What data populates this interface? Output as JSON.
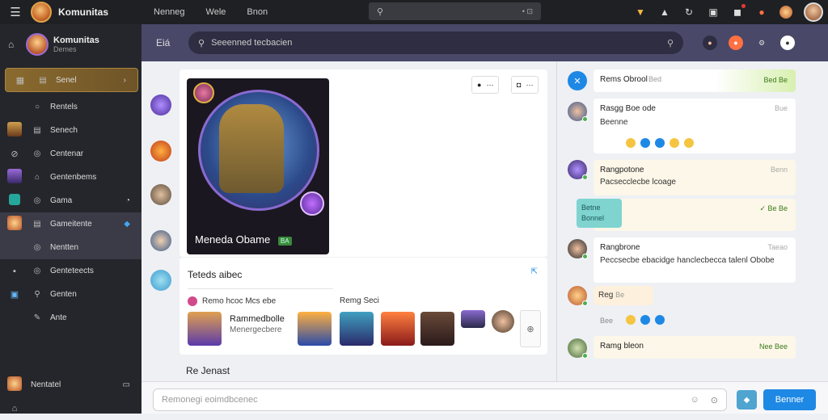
{
  "topbar": {
    "brand": "Komunitas",
    "nav": [
      "Nenneg",
      "Wele",
      "Bnon"
    ],
    "search_dots": "• ⊡"
  },
  "sidebar": {
    "title": "Komunitas",
    "subtitle": "Demes",
    "items": [
      {
        "label": "Senel",
        "end": "›"
      },
      {
        "label": "Rentels"
      },
      {
        "label": "Senech"
      },
      {
        "label": "Centenar"
      },
      {
        "label": "Gentenbems"
      },
      {
        "label": "Gama"
      },
      {
        "label": "Gameitente"
      },
      {
        "label": "Nentten"
      },
      {
        "label": "Genteteects"
      },
      {
        "label": "Genten"
      },
      {
        "label": "Ante"
      }
    ],
    "bottom_label": "Nentatel"
  },
  "subbar": {
    "back_label": "Eiá",
    "search_placeholder": "Seeenned tecbacien"
  },
  "game_card": {
    "title": "Meneda Obame",
    "tag": "BA",
    "btn1": "●",
    "btn2": "◘"
  },
  "lower_card": {
    "heading": "Teteds aibec",
    "col1": "Remo hcoc Mcs ebe",
    "col2": "Remg Seci",
    "game_name": "Rammedbolle",
    "game_sub": "Menergecbere"
  },
  "footer_label": "Re Jenast",
  "chat": [
    {
      "name": "Rems Obrool",
      "time": "Bed",
      "tag": "Bed Be"
    },
    {
      "name": "Rasgg Boe ode",
      "time": "Bue",
      "body": "Beenne"
    },
    {
      "name": "Rangpotone",
      "time": "Benn",
      "body": "Pacsecclecbe lcoage"
    },
    {
      "name": "Rangbrone",
      "time": "Taeao",
      "body": "Peccsecbe ebacidge hanclecbecca talenl Obobe"
    },
    {
      "name": "Reg",
      "time": "Be",
      "body": "Bee"
    },
    {
      "name": "Ramg bleon",
      "time": "Nee Bee"
    }
  ],
  "reply_card": {
    "line1": "Betne",
    "line2": "Bonnel"
  },
  "bottom": {
    "placeholder": "Remonegi eoimdbcenec",
    "send_label": "Benner"
  },
  "colors": {
    "topbar": "#1f2024",
    "sidebar": "#25262b",
    "subbar": "#4a4868",
    "accent": "#1e88e5",
    "active_item": "#8a6a2e"
  }
}
